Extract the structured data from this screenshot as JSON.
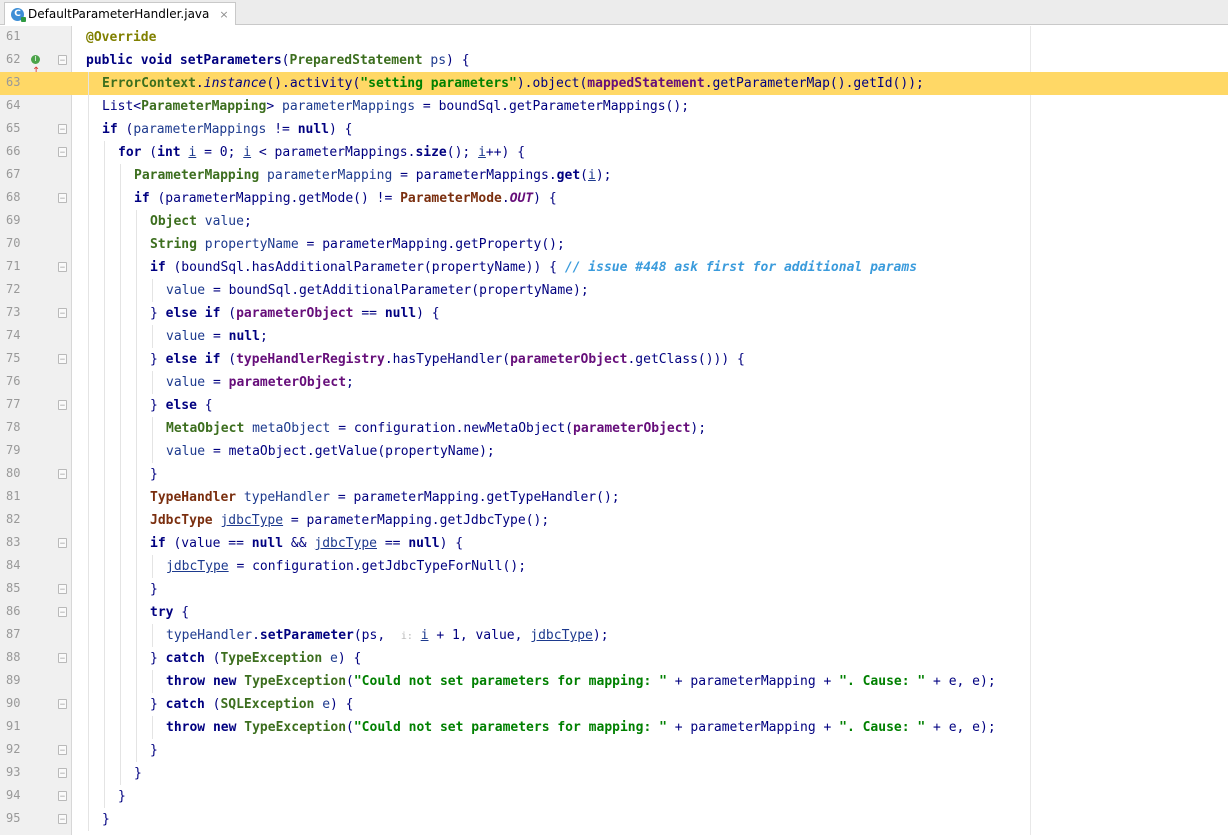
{
  "tab": {
    "filename": "DefaultParameterHandler.java",
    "icon_letter": "C",
    "close_glyph": "×"
  },
  "gutter": {
    "fold_open": "−",
    "fold_close": "−"
  },
  "lines": [
    {
      "n": "61",
      "indent": 0,
      "tokens": [
        [
          "ann",
          "@Override"
        ]
      ]
    },
    {
      "n": "62",
      "indent": 0,
      "override": true,
      "fold": true,
      "tokens": [
        [
          "kw",
          "public void "
        ],
        [
          "method",
          "setParameters"
        ],
        [
          "plain",
          "("
        ],
        [
          "type",
          "PreparedStatement"
        ],
        [
          "var",
          " ps"
        ],
        [
          "plain",
          ") {"
        ]
      ]
    },
    {
      "n": "63",
      "indent": 1,
      "current": true,
      "tokens": [
        [
          "type",
          "ErrorContext"
        ],
        [
          "plain",
          "."
        ],
        [
          "italic",
          "instance"
        ],
        [
          "plain",
          "().activity("
        ],
        [
          "str",
          "\"setting parameters\""
        ],
        [
          "plain",
          ").object("
        ],
        [
          "field",
          "mappedStatement"
        ],
        [
          "plain",
          ".getParameterMap().getId());"
        ]
      ]
    },
    {
      "n": "64",
      "indent": 1,
      "tokens": [
        [
          "plain",
          "List<"
        ],
        [
          "type",
          "ParameterMapping"
        ],
        [
          "plain",
          "> "
        ],
        [
          "var",
          "parameterMappings"
        ],
        [
          "plain",
          " = boundSql.getParameterMappings();"
        ]
      ]
    },
    {
      "n": "65",
      "indent": 1,
      "fold": true,
      "tokens": [
        [
          "kw",
          "if"
        ],
        [
          "plain",
          " ("
        ],
        [
          "var",
          "parameterMappings"
        ],
        [
          "plain",
          " != "
        ],
        [
          "kw",
          "null"
        ],
        [
          "plain",
          ") {"
        ]
      ]
    },
    {
      "n": "66",
      "indent": 2,
      "fold": true,
      "tokens": [
        [
          "kw",
          "for"
        ],
        [
          "plain",
          " ("
        ],
        [
          "kw",
          "int "
        ],
        [
          "ul",
          "i"
        ],
        [
          "plain",
          " = 0; "
        ],
        [
          "ul",
          "i"
        ],
        [
          "plain",
          " < parameterMappings."
        ],
        [
          "method",
          "size"
        ],
        [
          "plain",
          "(); "
        ],
        [
          "ul",
          "i"
        ],
        [
          "plain",
          "++) {"
        ]
      ]
    },
    {
      "n": "67",
      "indent": 3,
      "tokens": [
        [
          "type",
          "ParameterMapping"
        ],
        [
          "var",
          " parameterMapping"
        ],
        [
          "plain",
          " = parameterMappings."
        ],
        [
          "method",
          "get"
        ],
        [
          "plain",
          "("
        ],
        [
          "ul",
          "i"
        ],
        [
          "plain",
          ");"
        ]
      ]
    },
    {
      "n": "68",
      "indent": 3,
      "fold": true,
      "tokens": [
        [
          "kw",
          "if"
        ],
        [
          "plain",
          " (parameterMapping.getMode() != "
        ],
        [
          "dark",
          "ParameterMode"
        ],
        [
          "plain",
          "."
        ],
        [
          "sfield",
          "OUT"
        ],
        [
          "plain",
          ") {"
        ]
      ]
    },
    {
      "n": "69",
      "indent": 4,
      "tokens": [
        [
          "type",
          "Object"
        ],
        [
          "var",
          " value"
        ],
        [
          "plain",
          ";"
        ]
      ]
    },
    {
      "n": "70",
      "indent": 4,
      "tokens": [
        [
          "type",
          "String"
        ],
        [
          "var",
          " propertyName"
        ],
        [
          "plain",
          " = parameterMapping.getProperty();"
        ]
      ]
    },
    {
      "n": "71",
      "indent": 4,
      "fold": true,
      "tokens": [
        [
          "kw",
          "if"
        ],
        [
          "plain",
          " (boundSql.hasAdditionalParameter(propertyName)) { "
        ],
        [
          "cm",
          "// issue #448 ask first for additional params"
        ]
      ]
    },
    {
      "n": "72",
      "indent": 5,
      "tokens": [
        [
          "var",
          "value"
        ],
        [
          "plain",
          " = boundSql.getAdditionalParameter(propertyName);"
        ]
      ]
    },
    {
      "n": "73",
      "indent": 4,
      "fold": true,
      "tokens": [
        [
          "plain",
          "} "
        ],
        [
          "kw",
          "else if"
        ],
        [
          "plain",
          " ("
        ],
        [
          "field",
          "parameterObject"
        ],
        [
          "plain",
          " == "
        ],
        [
          "kw",
          "null"
        ],
        [
          "plain",
          ") {"
        ]
      ]
    },
    {
      "n": "74",
      "indent": 5,
      "tokens": [
        [
          "var",
          "value"
        ],
        [
          "plain",
          " = "
        ],
        [
          "kw",
          "null"
        ],
        [
          "plain",
          ";"
        ]
      ]
    },
    {
      "n": "75",
      "indent": 4,
      "fold": true,
      "tokens": [
        [
          "plain",
          "} "
        ],
        [
          "kw",
          "else if"
        ],
        [
          "plain",
          " ("
        ],
        [
          "field",
          "typeHandlerRegistry"
        ],
        [
          "plain",
          ".hasTypeHandler("
        ],
        [
          "field",
          "parameterObject"
        ],
        [
          "plain",
          ".getClass())) {"
        ]
      ]
    },
    {
      "n": "76",
      "indent": 5,
      "tokens": [
        [
          "var",
          "value"
        ],
        [
          "plain",
          " = "
        ],
        [
          "field",
          "parameterObject"
        ],
        [
          "plain",
          ";"
        ]
      ]
    },
    {
      "n": "77",
      "indent": 4,
      "fold": true,
      "tokens": [
        [
          "plain",
          "} "
        ],
        [
          "kw",
          "else"
        ],
        [
          "plain",
          " {"
        ]
      ]
    },
    {
      "n": "78",
      "indent": 5,
      "tokens": [
        [
          "type",
          "MetaObject"
        ],
        [
          "var",
          " metaObject"
        ],
        [
          "plain",
          " = configuration.newMetaObject("
        ],
        [
          "field",
          "parameterObject"
        ],
        [
          "plain",
          ");"
        ]
      ]
    },
    {
      "n": "79",
      "indent": 5,
      "tokens": [
        [
          "var",
          "value"
        ],
        [
          "plain",
          " = metaObject.getValue(propertyName);"
        ]
      ]
    },
    {
      "n": "80",
      "indent": 4,
      "fold": true,
      "tokens": [
        [
          "plain",
          "}"
        ]
      ]
    },
    {
      "n": "81",
      "indent": 4,
      "tokens": [
        [
          "dark",
          "TypeHandler"
        ],
        [
          "var",
          " typeHandler"
        ],
        [
          "plain",
          " = parameterMapping.getTypeHandler();"
        ]
      ]
    },
    {
      "n": "82",
      "indent": 4,
      "tokens": [
        [
          "dark",
          "JdbcType"
        ],
        [
          "plain",
          " "
        ],
        [
          "ul",
          "jdbcType"
        ],
        [
          "plain",
          " = parameterMapping.getJdbcType();"
        ]
      ]
    },
    {
      "n": "83",
      "indent": 4,
      "fold": true,
      "tokens": [
        [
          "kw",
          "if"
        ],
        [
          "plain",
          " (value == "
        ],
        [
          "kw",
          "null"
        ],
        [
          "plain",
          " && "
        ],
        [
          "ul",
          "jdbcType"
        ],
        [
          "plain",
          " == "
        ],
        [
          "kw",
          "null"
        ],
        [
          "plain",
          ") {"
        ]
      ]
    },
    {
      "n": "84",
      "indent": 5,
      "tokens": [
        [
          "ul",
          "jdbcType"
        ],
        [
          "plain",
          " = configuration.getJdbcTypeForNull();"
        ]
      ]
    },
    {
      "n": "85",
      "indent": 4,
      "fold": true,
      "tokens": [
        [
          "plain",
          "}"
        ]
      ]
    },
    {
      "n": "86",
      "indent": 4,
      "fold": true,
      "tokens": [
        [
          "kw",
          "try"
        ],
        [
          "plain",
          " {"
        ]
      ]
    },
    {
      "n": "87",
      "indent": 5,
      "tokens": [
        [
          "var",
          "typeHandler"
        ],
        [
          "plain",
          "."
        ],
        [
          "method",
          "setParameter"
        ],
        [
          "plain",
          "(ps,  "
        ],
        [
          "hint",
          "i:"
        ],
        [
          "plain",
          " "
        ],
        [
          "ul",
          "i"
        ],
        [
          "plain",
          " + 1, value, "
        ],
        [
          "ul",
          "jdbcType"
        ],
        [
          "plain",
          ");"
        ]
      ]
    },
    {
      "n": "88",
      "indent": 4,
      "fold": true,
      "tokens": [
        [
          "plain",
          "} "
        ],
        [
          "kw",
          "catch"
        ],
        [
          "plain",
          " ("
        ],
        [
          "type",
          "TypeException"
        ],
        [
          "var",
          " e"
        ],
        [
          "plain",
          ") {"
        ]
      ]
    },
    {
      "n": "89",
      "indent": 5,
      "tokens": [
        [
          "kw",
          "throw new "
        ],
        [
          "type",
          "TypeException"
        ],
        [
          "plain",
          "("
        ],
        [
          "str",
          "\"Could not set parameters for mapping: \""
        ],
        [
          "plain",
          " + parameterMapping + "
        ],
        [
          "str",
          "\". Cause: \""
        ],
        [
          "plain",
          " + e, e);"
        ]
      ]
    },
    {
      "n": "90",
      "indent": 4,
      "fold": true,
      "tokens": [
        [
          "plain",
          "} "
        ],
        [
          "kw",
          "catch"
        ],
        [
          "plain",
          " ("
        ],
        [
          "type",
          "SQLException"
        ],
        [
          "var",
          " e"
        ],
        [
          "plain",
          ") {"
        ]
      ]
    },
    {
      "n": "91",
      "indent": 5,
      "tokens": [
        [
          "kw",
          "throw new "
        ],
        [
          "type",
          "TypeException"
        ],
        [
          "plain",
          "("
        ],
        [
          "str",
          "\"Could not set parameters for mapping: \""
        ],
        [
          "plain",
          " + parameterMapping + "
        ],
        [
          "str",
          "\". Cause: \""
        ],
        [
          "plain",
          " + e, e);"
        ]
      ]
    },
    {
      "n": "92",
      "indent": 4,
      "fold": true,
      "tokens": [
        [
          "plain",
          "}"
        ]
      ]
    },
    {
      "n": "93",
      "indent": 3,
      "fold": true,
      "tokens": [
        [
          "plain",
          "}"
        ]
      ]
    },
    {
      "n": "94",
      "indent": 2,
      "fold": true,
      "tokens": [
        [
          "plain",
          "}"
        ]
      ]
    },
    {
      "n": "95",
      "indent": 1,
      "fold": true,
      "tokens": [
        [
          "plain",
          "}"
        ]
      ]
    }
  ]
}
